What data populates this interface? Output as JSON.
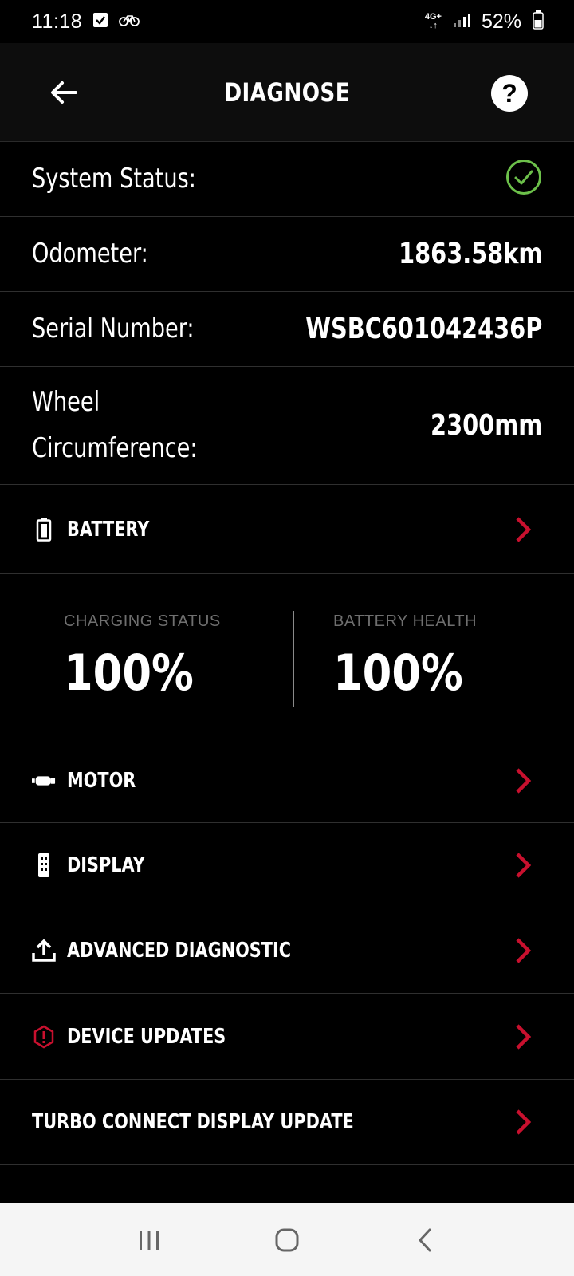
{
  "status_bar": {
    "time": "11:18",
    "network_type": "4G+",
    "battery_percent": "52%"
  },
  "header": {
    "title": "DIAGNOSE"
  },
  "info": {
    "system_status_label": "System Status:",
    "system_status_state": "ok",
    "odometer_label": "Odometer:",
    "odometer_value": "1863.58km",
    "serial_label": "Serial Number:",
    "serial_value": "WSBC601042436P",
    "wheel_label_line1": "Wheel",
    "wheel_label_line2": "Circumference:",
    "wheel_value": "2300mm"
  },
  "battery": {
    "label": "BATTERY",
    "charging_status_label": "CHARGING STATUS",
    "charging_status_value": "100%",
    "battery_health_label": "BATTERY HEALTH",
    "battery_health_value": "100%"
  },
  "sections": {
    "motor": "MOTOR",
    "display": "DISPLAY",
    "advanced_diagnostic": "ADVANCED DIAGNOSTIC",
    "device_updates": "DEVICE UPDATES",
    "turbo_connect": "TURBO CONNECT DISPLAY UPDATE"
  },
  "colors": {
    "accent_red": "#c8102e",
    "status_green": "#6cc04a"
  }
}
